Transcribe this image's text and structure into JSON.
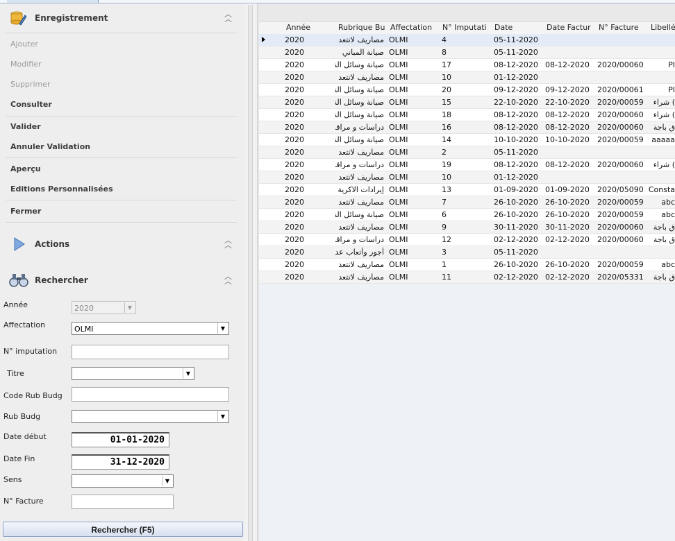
{
  "left_panel": {
    "enregistrement": {
      "title": "Enregistrement",
      "items": [
        {
          "label": "Ajouter",
          "enabled": false
        },
        {
          "label": "Modifier",
          "enabled": false
        },
        {
          "label": "Supprimer",
          "enabled": false
        },
        {
          "label": "Consulter",
          "enabled": true
        },
        {
          "label": "Valider",
          "enabled": true
        },
        {
          "label": "Annuler Validation",
          "enabled": true
        },
        {
          "label": "Aperçu",
          "enabled": true
        },
        {
          "label": "Editions Personnalisées",
          "enabled": true
        },
        {
          "label": "Fermer",
          "enabled": true
        }
      ]
    },
    "actions": {
      "title": "Actions"
    },
    "rechercher": {
      "title": "Rechercher",
      "fields": {
        "annee": {
          "label": "Année",
          "value": "2020"
        },
        "affectation": {
          "label": "Affectation",
          "value": "OLMI"
        },
        "n_imputation": {
          "label": "N° imputation",
          "value": ""
        },
        "titre": {
          "label": "Titre",
          "value": ""
        },
        "code_rub_budg": {
          "label": "Code Rub Budg",
          "value": ""
        },
        "rub_budg": {
          "label": "Rub Budg",
          "value": ""
        },
        "date_debut": {
          "label": "Date début",
          "value": "01-01-2020"
        },
        "date_fin": {
          "label": "Date Fin",
          "value": "31-12-2020"
        },
        "sens": {
          "label": "Sens",
          "value": ""
        },
        "n_facture": {
          "label": "N° Facture",
          "value": ""
        }
      },
      "button_label": "Rechercher (F5)"
    }
  },
  "grid": {
    "columns": [
      "Année",
      "Rubrique Bu",
      "Affectation",
      "N° Imputati",
      "Date",
      "Date Factur",
      "N° Facture",
      "Libellé"
    ],
    "rows": [
      [
        "2020",
        "مصاريف لاتتعد",
        "OLMI",
        "4",
        "05-11-2020",
        "",
        "",
        ""
      ],
      [
        "2020",
        "صيانة المباني",
        "OLMI",
        "8",
        "05-11-2020",
        "",
        "",
        ""
      ],
      [
        "2020",
        "صيانة وسائل النة",
        "OLMI",
        "17",
        "08-12-2020",
        "08-12-2020",
        "2020/00060",
        "PI"
      ],
      [
        "2020",
        "مصاريف لاتتعد",
        "OLMI",
        "10",
        "01-12-2020",
        "",
        "",
        ""
      ],
      [
        "2020",
        "صيانة وسائل النة",
        "OLMI",
        "20",
        "09-12-2020",
        "09-12-2020",
        "2020/00061",
        "PI"
      ],
      [
        "2020",
        "صيانة وسائل النة",
        "OLMI",
        "15",
        "22-10-2020",
        "22-10-2020",
        "2020/00059",
        ") شراء"
      ],
      [
        "2020",
        "صيانة وسائل النة",
        "OLMI",
        "18",
        "08-12-2020",
        "08-12-2020",
        "2020/00060",
        ") شراء"
      ],
      [
        "2020",
        "دراسات و مراقبة",
        "OLMI",
        "16",
        "08-12-2020",
        "08-12-2020",
        "2020/00060",
        "ق باجة"
      ],
      [
        "2020",
        "صيانة وسائل النة",
        "OLMI",
        "14",
        "10-10-2020",
        "10-10-2020",
        "2020/00059",
        "aaaaa"
      ],
      [
        "2020",
        "مصاريف لاتتعد",
        "OLMI",
        "2",
        "05-11-2020",
        "",
        "",
        ""
      ],
      [
        "2020",
        "دراسات و مراقبة",
        "OLMI",
        "19",
        "08-12-2020",
        "08-12-2020",
        "2020/00060",
        ") شراء"
      ],
      [
        "2020",
        "مصاريف لاتتعد",
        "OLMI",
        "10",
        "01-12-2020",
        "",
        "",
        ""
      ],
      [
        "2020",
        "إيرادات الاكرية",
        "OLMI",
        "13",
        "01-09-2020",
        "01-09-2020",
        "2020/05090",
        "Consta"
      ],
      [
        "2020",
        "مصاريف لاتتعد",
        "OLMI",
        "7",
        "26-10-2020",
        "26-10-2020",
        "2020/00059",
        "abc"
      ],
      [
        "2020",
        "صيانة وسائل النة",
        "OLMI",
        "6",
        "26-10-2020",
        "26-10-2020",
        "2020/00059",
        "abc"
      ],
      [
        "2020",
        "مصاريف لاتتعد",
        "OLMI",
        "9",
        "30-11-2020",
        "30-11-2020",
        "2020/00060",
        "ق باجة"
      ],
      [
        "2020",
        "دراسات و مراقبة",
        "OLMI",
        "12",
        "02-12-2020",
        "02-12-2020",
        "2020/00060",
        "ق باجة"
      ],
      [
        "2020",
        "أجور وأتعاب عد",
        "OLMI",
        "3",
        "05-11-2020",
        "",
        "",
        ""
      ],
      [
        "2020",
        "مصاريف لاتتعد",
        "OLMI",
        "1",
        "26-10-2020",
        "26-10-2020",
        "2020/00059",
        "abc"
      ],
      [
        "2020",
        "مصاريف لاتتعد",
        "OLMI",
        "11",
        "02-12-2020",
        "02-12-2020",
        "2020/05331",
        "ق باجة"
      ]
    ],
    "selected_row": 0
  },
  "colors": {
    "panel_bg": "#eeeeee",
    "selected_row": "#e4ebf8",
    "button_border": "#8ea3c8"
  }
}
